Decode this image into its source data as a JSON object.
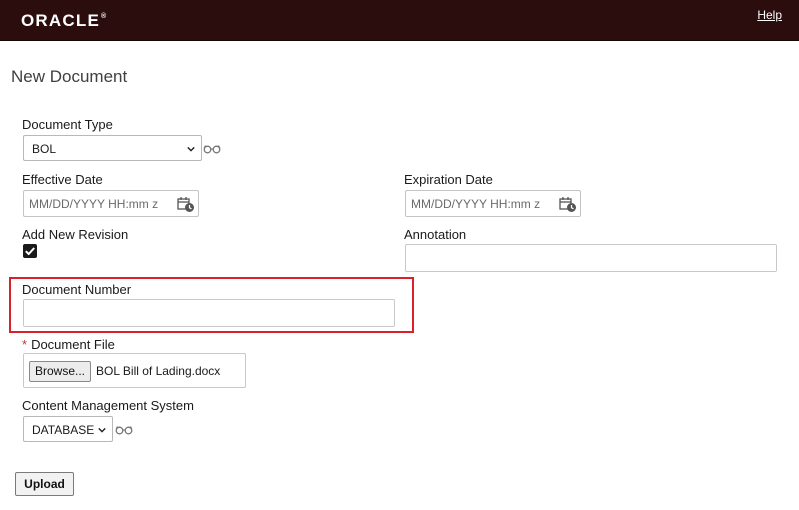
{
  "header": {
    "logo_text": "ORACLE",
    "logo_mark": "®",
    "help_label": "Help",
    "bg_color": "#2b0d0d"
  },
  "page": {
    "title": "New Document"
  },
  "form": {
    "document_type": {
      "label": "Document Type",
      "value": "BOL"
    },
    "effective_date": {
      "label": "Effective Date",
      "placeholder": "MM/DD/YYYY HH:mm z",
      "value": ""
    },
    "expiration_date": {
      "label": "Expiration Date",
      "placeholder": "MM/DD/YYYY HH:mm z",
      "value": ""
    },
    "add_new_revision": {
      "label": "Add New Revision",
      "checked": true
    },
    "annotation": {
      "label": "Annotation",
      "value": ""
    },
    "document_number": {
      "label": "Document Number",
      "value": ""
    },
    "document_file": {
      "required_mark": "*",
      "label": "Document File",
      "browse_label": "Browse...",
      "file_name": "BOL Bill of Lading.docx"
    },
    "content_management_system": {
      "label": "Content Management System",
      "value": "DATABASE"
    },
    "upload_label": "Upload"
  },
  "highlight_color": "#d9212b",
  "icons": {
    "lookup": "glasses-icon",
    "calendar": "calendar-clock-icon",
    "dropdown": "chevron-down-icon",
    "check": "check-icon"
  }
}
